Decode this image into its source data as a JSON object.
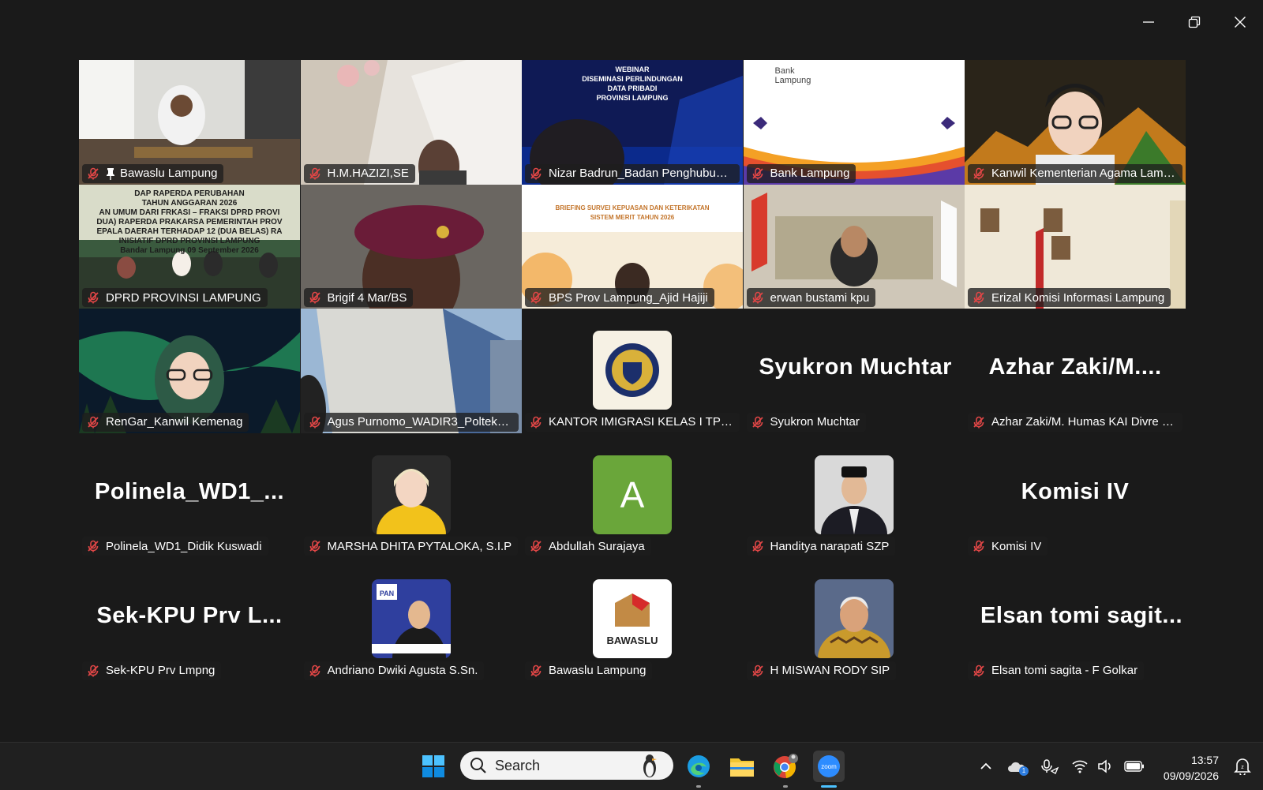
{
  "window": {
    "controls": {
      "minimize": "minimize-icon",
      "restore": "restore-icon",
      "close": "close-icon"
    }
  },
  "colors": {
    "background": "#1a1a1a",
    "active_speaker": "#2ecc71",
    "muted_mic": "#e04646",
    "taskbar": "#202020"
  },
  "participants": [
    {
      "name": "Bawaslu Lampung",
      "pinned": true,
      "kind": "video"
    },
    {
      "name": "H.M.HAZIZI,SE",
      "kind": "video"
    },
    {
      "name": "Nizar Badrun_Badan Penghubung...",
      "kind": "video",
      "slide_lines": [
        "WEBINAR",
        "DISEMINASI PERLINDUNGAN",
        "DATA PRIBADI",
        "PROVINSI LAMPUNG"
      ]
    },
    {
      "name": "Bank Lampung",
      "kind": "video",
      "logo_text": "Bank Lampung"
    },
    {
      "name": "Kanwil Kementerian Agama Lamp...",
      "kind": "video"
    },
    {
      "name": "DPRD PROVINSI LAMPUNG",
      "kind": "video",
      "active": true,
      "slide_lines": [
        "DAP RAPERDA PERUBAHAN",
        "TAHUN ANGGARAN 2026",
        "AN UMUM DARI FRKASI – FRAKSI DPRD PROVI",
        "DUA) RAPERDA PRAKARSA PEMERINTAH PROV",
        "EPALA DAERAH TERHADAP 12 (DUA BELAS) RA",
        "INISIATIF DPRD PROVINSI LAMPUNG",
        "Bandar Lampung 09 September 2026"
      ]
    },
    {
      "name": "Brigif 4 Mar/BS",
      "kind": "video"
    },
    {
      "name": "BPS Prov Lampung_Ajid Hajiji",
      "kind": "video",
      "slide_lines": [
        "BRIEFING SURVEI KEPUASAN DAN KETERIKATAN",
        "SISTEM MERIT TAHUN 2026"
      ]
    },
    {
      "name": "erwan bustami kpu",
      "kind": "video"
    },
    {
      "name": "Erizal Komisi Informasi Lampung",
      "kind": "video"
    },
    {
      "name": "RenGar_Kanwil Kemenag",
      "kind": "video"
    },
    {
      "name": "Agus Purnomo_WADIR3_Poltekkes...",
      "kind": "video"
    },
    {
      "name": "KANTOR IMIGRASI KELAS I TPI BA...",
      "kind": "avatar",
      "avatar": "imigrasi-logo"
    },
    {
      "name": "Syukron Muchtar",
      "kind": "text",
      "display": "Syukron Muchtar"
    },
    {
      "name": "Azhar Zaki/M. Humas KAI Divre IV...",
      "kind": "text",
      "display": "Azhar  Zaki/M...."
    },
    {
      "name": "Polinela_WD1_Didik Kuswadi",
      "kind": "text",
      "display": "Polinela_WD1_..."
    },
    {
      "name": "MARSHA DHITA PYTALOKA, S.I.P",
      "kind": "avatar",
      "avatar": "photo-yellow"
    },
    {
      "name": "Abdullah Surajaya",
      "kind": "avatar",
      "avatar": "letter",
      "letter": "A"
    },
    {
      "name": "Handitya narapati SZP",
      "kind": "avatar",
      "avatar": "photo-suit"
    },
    {
      "name": "Komisi IV",
      "kind": "text",
      "display": "Komisi IV"
    },
    {
      "name": "Sek-KPU Prv Lmpng",
      "kind": "text",
      "display": "Sek-KPU Prv L..."
    },
    {
      "name": "Andriano Dwiki Agusta S.Sn.",
      "kind": "avatar",
      "avatar": "pan-poster",
      "poster_text": "PAN"
    },
    {
      "name": "Bawaslu Lampung",
      "kind": "avatar",
      "avatar": "bawaslu-logo",
      "logo_text": "BAWASLU"
    },
    {
      "name": "H MISWAN RODY SIP",
      "kind": "avatar",
      "avatar": "photo-batik"
    },
    {
      "name": "Elsan tomi sagita - F Golkar",
      "kind": "text",
      "display": "Elsan  tomi sagit..."
    }
  ],
  "taskbar": {
    "search_placeholder": "Search",
    "apps": [
      "windows-start-icon",
      "edge-icon",
      "file-explorer-icon",
      "chrome-icon",
      "zoom-icon"
    ],
    "zoom_label": "zoom",
    "tray": [
      "chevron-up-icon",
      "onedrive-icon",
      "microphone-icon",
      "wifi-icon",
      "volume-icon",
      "battery-icon",
      "notification-icon"
    ],
    "onedrive_badge": "1",
    "time": "13:57",
    "date": "09/09/2026"
  }
}
